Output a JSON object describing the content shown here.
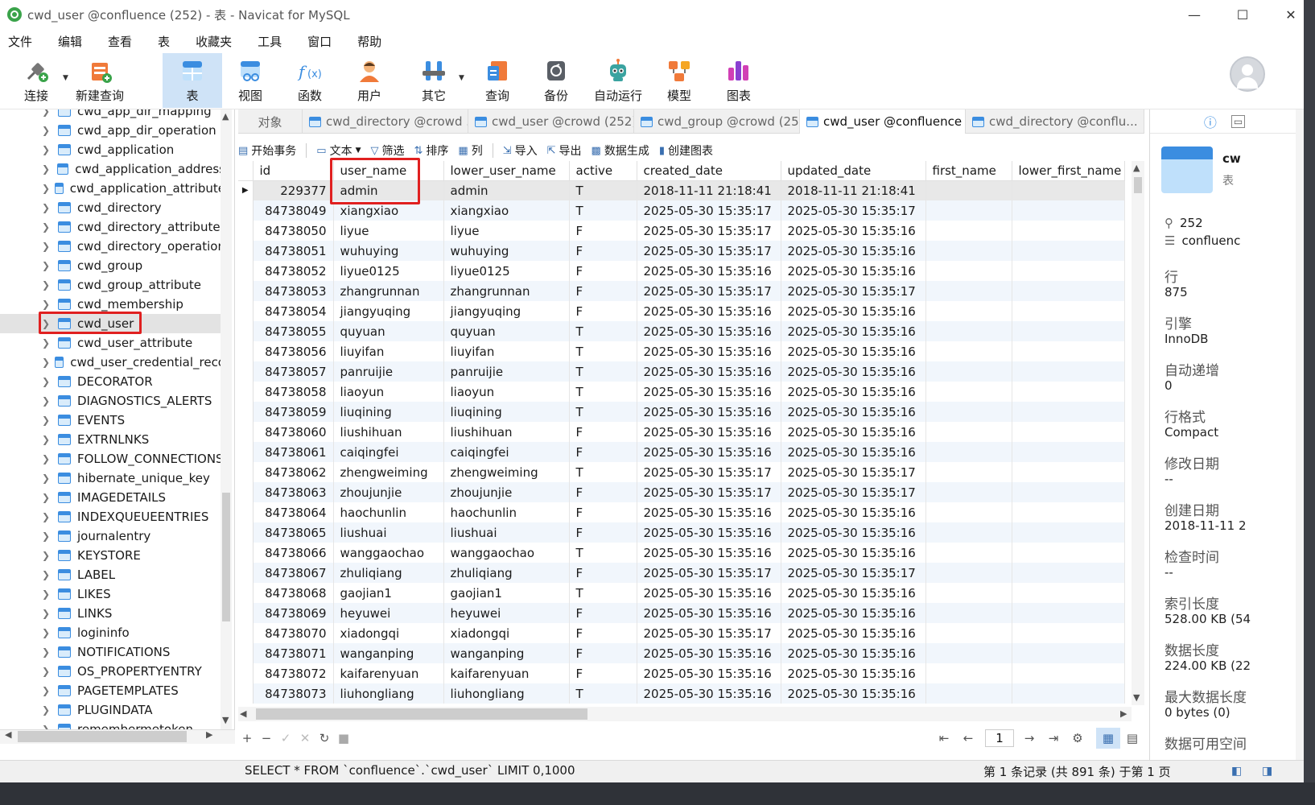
{
  "window": {
    "title": "cwd_user @confluence (252) - 表 - Navicat for MySQL",
    "controls": [
      "—",
      "☐",
      "✕"
    ]
  },
  "menu": [
    "文件",
    "编辑",
    "查看",
    "表",
    "收藏夹",
    "工具",
    "窗口",
    "帮助"
  ],
  "toolbar": {
    "buttons": [
      {
        "label": "连接",
        "icon": "connection-plug-icon"
      },
      {
        "label": "新建查询",
        "icon": "new-query-icon"
      },
      {
        "label": "表",
        "icon": "table-icon"
      },
      {
        "label": "视图",
        "icon": "view-icon"
      },
      {
        "label": "函数",
        "icon": "function-icon"
      },
      {
        "label": "用户",
        "icon": "user-icon"
      },
      {
        "label": "其它",
        "icon": "tools-icon"
      },
      {
        "label": "查询",
        "icon": "query-icon"
      },
      {
        "label": "备份",
        "icon": "backup-icon"
      },
      {
        "label": "自动运行",
        "icon": "robot-icon"
      },
      {
        "label": "模型",
        "icon": "model-icon"
      },
      {
        "label": "图表",
        "icon": "chart-icon"
      }
    ]
  },
  "tree": {
    "items": [
      "cwd_app_dir_mapping",
      "cwd_app_dir_operation",
      "cwd_application",
      "cwd_application_address",
      "cwd_application_attribute",
      "cwd_directory",
      "cwd_directory_attribute",
      "cwd_directory_operation",
      "cwd_group",
      "cwd_group_attribute",
      "cwd_membership",
      "cwd_user",
      "cwd_user_attribute",
      "cwd_user_credential_reco",
      "DECORATOR",
      "DIAGNOSTICS_ALERTS",
      "EVENTS",
      "EXTRNLNKS",
      "FOLLOW_CONNECTIONS",
      "hibernate_unique_key",
      "IMAGEDETAILS",
      "INDEXQUEUEENTRIES",
      "journalentry",
      "KEYSTORE",
      "LABEL",
      "LIKES",
      "LINKS",
      "logininfo",
      "NOTIFICATIONS",
      "OS_PROPERTYENTRY",
      "PAGETEMPLATES",
      "PLUGINDATA",
      "remembermetoken"
    ],
    "selected": "cwd_user"
  },
  "tabs": [
    {
      "label": "对象",
      "icon": false
    },
    {
      "label": "cwd_directory @crowd ...",
      "icon": true
    },
    {
      "label": "cwd_user @crowd (252)...",
      "icon": true
    },
    {
      "label": "cwd_group @crowd (25...",
      "icon": true
    },
    {
      "label": "cwd_user @confluence ...",
      "icon": true,
      "active": true
    },
    {
      "label": "cwd_directory @conflu...",
      "icon": true
    }
  ],
  "grid_toolbar": [
    "开始事务",
    "文本",
    "筛选",
    "排序",
    "列",
    "导入",
    "导出",
    "数据生成",
    "创建图表"
  ],
  "table": {
    "columns": [
      "id",
      "user_name",
      "lower_user_name",
      "active",
      "created_date",
      "updated_date",
      "first_name",
      "lower_first_name"
    ],
    "rows": [
      [
        "229377",
        "admin",
        "admin",
        "T",
        "2018-11-11 21:18:41",
        "2018-11-11 21:18:41",
        "",
        ""
      ],
      [
        "84738049",
        "xiangxiao",
        "xiangxiao",
        "T",
        "2025-05-30 15:35:17",
        "2025-05-30 15:35:17",
        "",
        ""
      ],
      [
        "84738050",
        "liyue",
        "liyue",
        "F",
        "2025-05-30 15:35:17",
        "2025-05-30 15:35:16",
        "",
        ""
      ],
      [
        "84738051",
        "wuhuying",
        "wuhuying",
        "F",
        "2025-05-30 15:35:17",
        "2025-05-30 15:35:16",
        "",
        ""
      ],
      [
        "84738052",
        "liyue0125",
        "liyue0125",
        "F",
        "2025-05-30 15:35:16",
        "2025-05-30 15:35:16",
        "",
        ""
      ],
      [
        "84738053",
        "zhangrunnan",
        "zhangrunnan",
        "F",
        "2025-05-30 15:35:17",
        "2025-05-30 15:35:17",
        "",
        ""
      ],
      [
        "84738054",
        "jiangyuqing",
        "jiangyuqing",
        "F",
        "2025-05-30 15:35:16",
        "2025-05-30 15:35:16",
        "",
        ""
      ],
      [
        "84738055",
        "quyuan",
        "quyuan",
        "T",
        "2025-05-30 15:35:16",
        "2025-05-30 15:35:16",
        "",
        ""
      ],
      [
        "84738056",
        "liuyifan",
        "liuyifan",
        "T",
        "2025-05-30 15:35:16",
        "2025-05-30 15:35:16",
        "",
        ""
      ],
      [
        "84738057",
        "panruijie",
        "panruijie",
        "T",
        "2025-05-30 15:35:16",
        "2025-05-30 15:35:16",
        "",
        ""
      ],
      [
        "84738058",
        "liaoyun",
        "liaoyun",
        "T",
        "2025-05-30 15:35:16",
        "2025-05-30 15:35:16",
        "",
        ""
      ],
      [
        "84738059",
        "liuqining",
        "liuqining",
        "T",
        "2025-05-30 15:35:16",
        "2025-05-30 15:35:16",
        "",
        ""
      ],
      [
        "84738060",
        "liushihuan",
        "liushihuan",
        "F",
        "2025-05-30 15:35:16",
        "2025-05-30 15:35:16",
        "",
        ""
      ],
      [
        "84738061",
        "caiqingfei",
        "caiqingfei",
        "F",
        "2025-05-30 15:35:16",
        "2025-05-30 15:35:16",
        "",
        ""
      ],
      [
        "84738062",
        "zhengweiming",
        "zhengweiming",
        "T",
        "2025-05-30 15:35:17",
        "2025-05-30 15:35:17",
        "",
        ""
      ],
      [
        "84738063",
        "zhoujunjie",
        "zhoujunjie",
        "F",
        "2025-05-30 15:35:17",
        "2025-05-30 15:35:17",
        "",
        ""
      ],
      [
        "84738064",
        "haochunlin",
        "haochunlin",
        "F",
        "2025-05-30 15:35:16",
        "2025-05-30 15:35:16",
        "",
        ""
      ],
      [
        "84738065",
        "liushuai",
        "liushuai",
        "F",
        "2025-05-30 15:35:16",
        "2025-05-30 15:35:16",
        "",
        ""
      ],
      [
        "84738066",
        "wanggaochao",
        "wanggaochao",
        "T",
        "2025-05-30 15:35:16",
        "2025-05-30 15:35:16",
        "",
        ""
      ],
      [
        "84738067",
        "zhuliqiang",
        "zhuliqiang",
        "F",
        "2025-05-30 15:35:17",
        "2025-05-30 15:35:17",
        "",
        ""
      ],
      [
        "84738068",
        "gaojian1",
        "gaojian1",
        "T",
        "2025-05-30 15:35:16",
        "2025-05-30 15:35:16",
        "",
        ""
      ],
      [
        "84738069",
        "heyuwei",
        "heyuwei",
        "F",
        "2025-05-30 15:35:16",
        "2025-05-30 15:35:16",
        "",
        ""
      ],
      [
        "84738070",
        "xiadongqi",
        "xiadongqi",
        "F",
        "2025-05-30 15:35:17",
        "2025-05-30 15:35:16",
        "",
        ""
      ],
      [
        "84738071",
        "wanganping",
        "wanganping",
        "F",
        "2025-05-30 15:35:16",
        "2025-05-30 15:35:16",
        "",
        ""
      ],
      [
        "84738072",
        "kaifarenyuan",
        "kaifarenyuan",
        "F",
        "2025-05-30 15:35:16",
        "2025-05-30 15:35:16",
        "",
        ""
      ],
      [
        "84738073",
        "liuhongliang",
        "liuhongliang",
        "T",
        "2025-05-30 15:35:16",
        "2025-05-30 15:35:16",
        "",
        ""
      ]
    ]
  },
  "bottom_nav": {
    "page": "1",
    "buttons": [
      "+",
      "−",
      "✓",
      "✕",
      "↻",
      "■"
    ],
    "pager": [
      "⇤",
      "←",
      "→",
      "⇥",
      "⚙"
    ]
  },
  "status": {
    "sql": "SELECT * FROM `confluence`.`cwd_user` LIMIT 0,1000",
    "info": "第 1 条记录 (共 891 条) 于第 1 页"
  },
  "info_panel": {
    "name": "cw",
    "type": "表",
    "rows_meta": "252",
    "db_meta": "confluenc",
    "fields": [
      {
        "label": "行",
        "value": "875"
      },
      {
        "label": "引擎",
        "value": "InnoDB"
      },
      {
        "label": "自动递增",
        "value": "0"
      },
      {
        "label": "行格式",
        "value": "Compact"
      },
      {
        "label": "修改日期",
        "value": "--"
      },
      {
        "label": "创建日期",
        "value": "2018-11-11 2"
      },
      {
        "label": "检查时间",
        "value": "--"
      },
      {
        "label": "索引长度",
        "value": "528.00 KB (54"
      },
      {
        "label": "数据长度",
        "value": "224.00 KB (22"
      },
      {
        "label": "最大数据长度",
        "value": "0 bytes (0)"
      },
      {
        "label": "数据可用空间",
        "value": ""
      }
    ]
  },
  "colors": {
    "accent": "#3b8de0",
    "highlight_box": "#e02020",
    "toolbar_active": "#cfe3f7",
    "alt_row": "#f1f6fc"
  }
}
